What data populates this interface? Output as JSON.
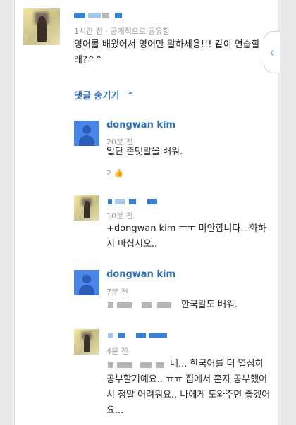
{
  "post": {
    "meta": "1시간 전 · 공개적으로 공유함",
    "text": "영어를 배웠어서 영어만 말하세용!!! 같이 연습할래?^^"
  },
  "comments_toggle": "댓글 숨기기",
  "comments": [
    {
      "author": "dongwan kim",
      "time": "20분 전",
      "text": "일단 존댓말을 배워.",
      "plus": "2"
    },
    {
      "author": "",
      "time": "10분 전",
      "text": "+dongwan kim ㅜㅜ 미안합니다.. 화하지 마십시오.."
    },
    {
      "author": "dongwan kim",
      "time": "7분 전",
      "text": "한국말도 배워."
    },
    {
      "author": "",
      "time": "4분 전",
      "text": "네... 한국어를 더 열심히 공부할거예요.. ㅠㅠ 집에서 혼자 공부했어서 정말 어려워요.. 나에게 도와주면 좋겠어요..."
    }
  ],
  "icons": {
    "side_tab": "chevron-left-icon",
    "toggle": "chevron-up-icon",
    "plus": "plus-one-icon"
  }
}
